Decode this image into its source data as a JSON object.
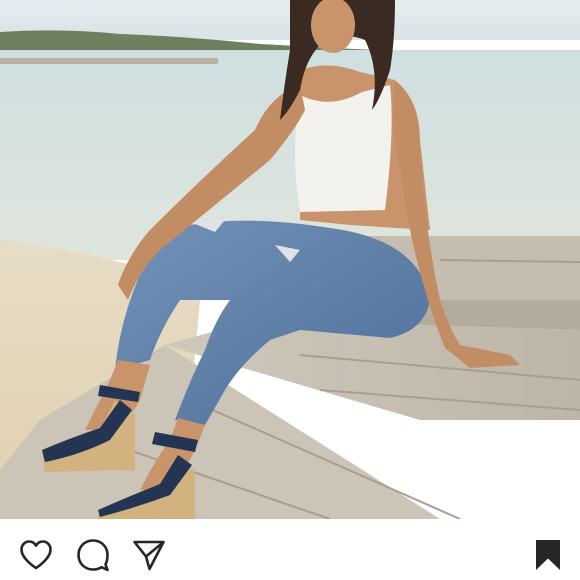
{
  "post": {
    "photo": {
      "subject": "woman-seated-on-wooden-steps-at-beach"
    },
    "actions": {
      "like": {
        "icon": "heart-outline-icon",
        "active": false
      },
      "comment": {
        "icon": "speech-bubble-icon"
      },
      "share": {
        "icon": "paper-plane-icon"
      },
      "save": {
        "icon": "bookmark-icon",
        "active": true
      }
    }
  },
  "colors": {
    "icon": "#262626",
    "background": "#ffffff",
    "sky": "#dfe8ec",
    "sea": "#c9dad9",
    "sand": "#eadcc2",
    "wood": "#c9c2b6",
    "denim": "#5d7fa7",
    "top": "#f4f2ee",
    "shoes": "#243554"
  }
}
